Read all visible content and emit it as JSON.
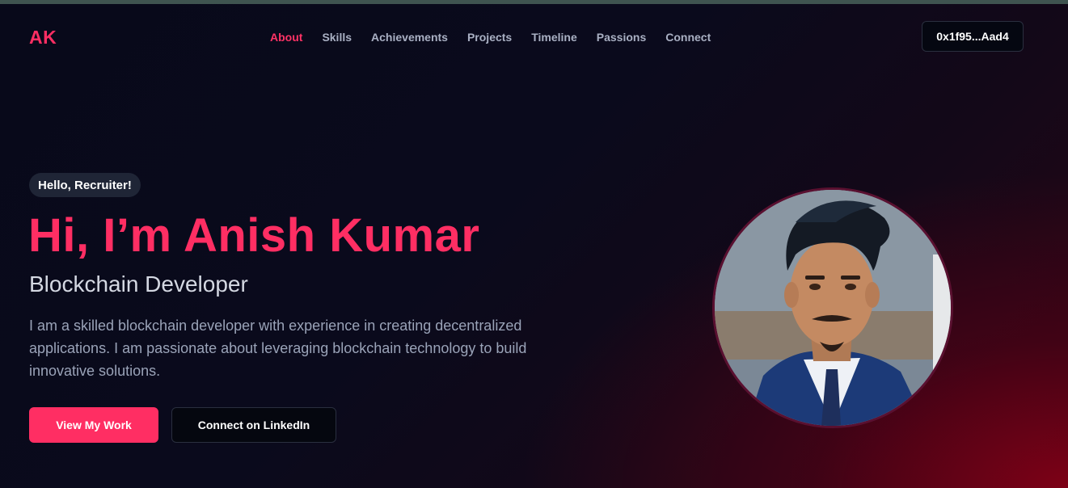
{
  "nav": {
    "logo": "AK",
    "links": [
      {
        "label": "About",
        "active": true
      },
      {
        "label": "Skills"
      },
      {
        "label": "Achievements"
      },
      {
        "label": "Projects"
      },
      {
        "label": "Timeline"
      },
      {
        "label": "Passions"
      },
      {
        "label": "Connect"
      }
    ],
    "wallet": "0x1f95...Aad4"
  },
  "hero": {
    "greeting_badge": "Hello, Recruiter!",
    "headline": "Hi, I’m Anish Kumar",
    "role": "Blockchain Developer",
    "intro": "I am a skilled blockchain developer with experience in creating decentralized applications. I am passionate about leveraging blockchain technology to build innovative solutions.",
    "primary_button": "View My Work",
    "secondary_button": "Connect on LinkedIn"
  },
  "colors": {
    "accent": "#ff2e63",
    "background": "#08091a",
    "muted_text": "#9aa3b8"
  },
  "icons": {
    "avatar": "profile-photo"
  }
}
